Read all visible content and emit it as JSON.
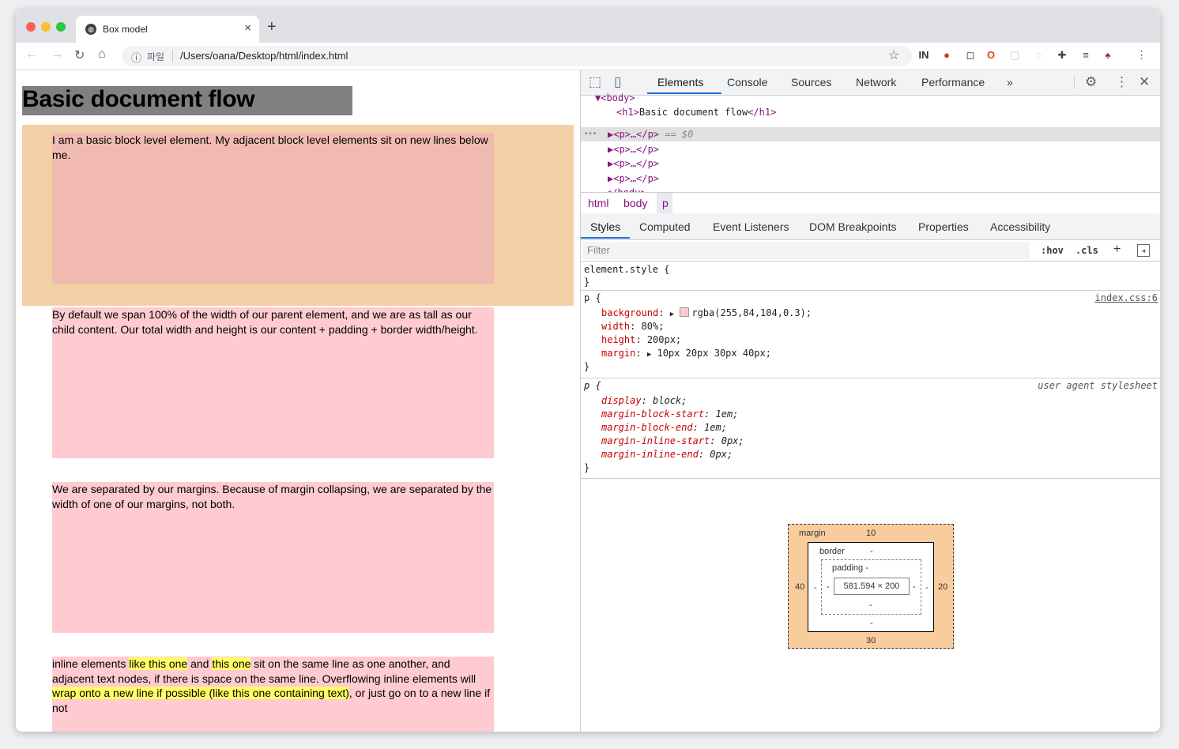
{
  "browser": {
    "tab_title": "Box model",
    "tab_close": "×",
    "new_tab": "+",
    "scheme_label": "파일",
    "url": "/Users/oana/Desktop/html/index.html",
    "info_icon": "ⓘ"
  },
  "page": {
    "heading": "Basic document flow",
    "p1": "I am a basic block level element. My adjacent block level elements sit on new lines below me.",
    "p2": "By default we span 100% of the width of our parent element, and we are as tall as our child content. Our total width and height is our content + padding + border width/height.",
    "p3": "We are separated by our margins. Because of margin collapsing, we are separated by the width of one of our margins, not both.",
    "p4_a": "inline elements ",
    "p4_hl1": "like this one",
    "p4_b": " and ",
    "p4_hl2": "this one",
    "p4_c": " sit on the same line as one another, and adjacent text nodes, if there is space on the same line. Overflowing inline elements will ",
    "p4_hl3": "wrap onto a new line if possible (like this one containing text)",
    "p4_d": ", or just go on to a new line if not",
    "highlight_color": "#ffff66",
    "p_background": "rgba(255,84,104,0.3)",
    "margin_overlay_color": "#f9cc9d"
  },
  "devtools": {
    "tabs": [
      "Elements",
      "Console",
      "Sources",
      "Network",
      "Performance",
      "»"
    ],
    "dom": {
      "body_open": "▼<body>",
      "h1_open": "<h1>",
      "h1_text": "Basic document flow",
      "h1_close": "</h1>",
      "ellipsis": "•••",
      "selected_p": "▶<p>…</p>",
      "selected_suffix": " == $0",
      "p_collapsed": "▶<p>…</p>",
      "body_close": "</body>"
    },
    "breadcrumbs": [
      "html",
      "body",
      "p"
    ],
    "style_tabs": [
      "Styles",
      "Computed",
      "Event Listeners",
      "DOM Breakpoints",
      "Properties",
      "Accessibility"
    ],
    "filter_placeholder": "Filter",
    "hov": ":hov",
    "cls": ".cls",
    "plus": "+",
    "rules": {
      "element_style_open": "element.style {",
      "close": "}",
      "p_open": "p {",
      "p_source": "index.css:6",
      "background_prop": "background",
      "background_val": "rgba(255,84,104,0.3);",
      "width_prop": "width",
      "width_val": "80%;",
      "height_prop": "height",
      "height_val": "200px;",
      "margin_prop": "margin",
      "margin_val": "10px 20px 30px 40px;",
      "ua_source": "user agent stylesheet",
      "display_prop": "display",
      "display_val": "block;",
      "mbs_prop": "margin-block-start",
      "mbs_val": "1em;",
      "mbe_prop": "margin-block-end",
      "mbe_val": "1em;",
      "mis_prop": "margin-inline-start",
      "mis_val": "0px;",
      "mie_prop": "margin-inline-end",
      "mie_val": "0px;"
    },
    "box_model": {
      "margin_label": "margin",
      "margin_top": "10",
      "margin_right": "20",
      "margin_bottom": "30",
      "margin_left": "40",
      "border_label": "border",
      "border_val": "-",
      "padding_label": "padding -",
      "content": "581.594 × 200",
      "dash": "-"
    }
  }
}
